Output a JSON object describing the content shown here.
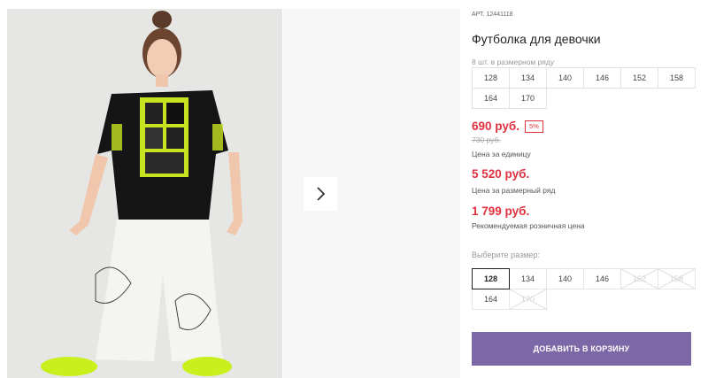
{
  "product": {
    "sku_label": "АРТ.",
    "sku_value": "12441118",
    "title": "Футболка для девочки",
    "pack_note": "8 шт. в размерном ряду",
    "pack_sizes": [
      "128",
      "134",
      "140",
      "146",
      "152",
      "158",
      "164",
      "170"
    ]
  },
  "pricing": {
    "unit_price": "690 руб.",
    "discount_badge": "5%",
    "old_price": "730 руб.",
    "unit_caption": "Цена за единицу",
    "pack_price": "5 520 руб.",
    "pack_caption": "Цена за размерный ряд",
    "retail_price": "1 799 руб.",
    "retail_caption": "Рекомендуемая розничная цена",
    "accent_color": "#e0313f"
  },
  "size_selector": {
    "label": "Выберите размер:",
    "options": [
      {
        "value": "128",
        "state": "selected"
      },
      {
        "value": "134",
        "state": "available"
      },
      {
        "value": "140",
        "state": "available"
      },
      {
        "value": "146",
        "state": "available"
      },
      {
        "value": "152",
        "state": "unavailable"
      },
      {
        "value": "158",
        "state": "unavailable"
      },
      {
        "value": "164",
        "state": "available"
      },
      {
        "value": "170",
        "state": "unavailable"
      }
    ]
  },
  "cart": {
    "add_button": "Добавить в корзину",
    "button_color": "#7c68a6"
  },
  "gallery": {
    "next_icon": "chevron-right-icon"
  }
}
